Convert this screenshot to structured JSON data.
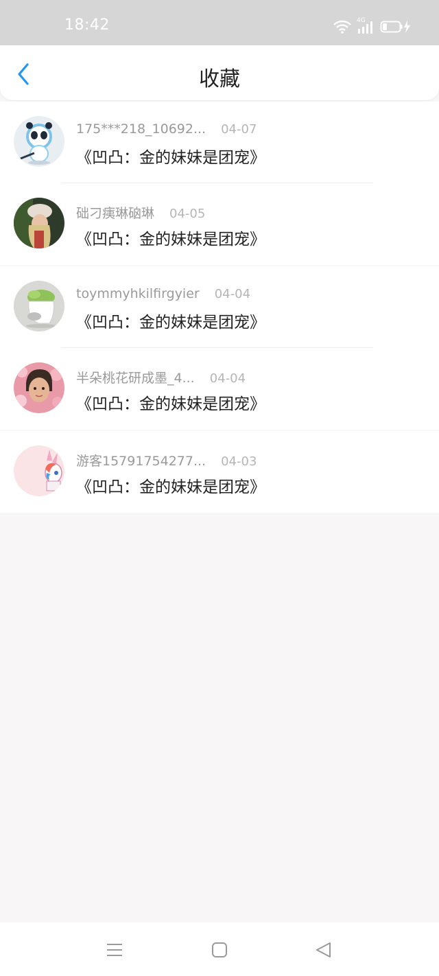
{
  "status_bar": {
    "time": "18:42",
    "icons": [
      "wifi-icon",
      "signal-4g-icon",
      "battery-charging-icon"
    ],
    "network_label": "4G"
  },
  "header": {
    "title": "收藏",
    "back_icon": "chevron-left-icon",
    "accent_color": "#2196f3"
  },
  "favorites": [
    {
      "user": "175***218_10692...",
      "date": "04-07",
      "title": "《凹凸：金的妹妹是团宠》",
      "avatar": "panda-mascot"
    },
    {
      "user": "础刁痍琳硇琳",
      "date": "04-05",
      "title": "《凹凸：金的妹妹是团宠》",
      "avatar": "person-hat"
    },
    {
      "user": "toymmyhkilfirgyier",
      "date": "04-04",
      "title": "《凹凸：金的妹妹是团宠》",
      "avatar": "plant-pot"
    },
    {
      "user": "半朵桃花研成墨_4...",
      "date": "04-04",
      "title": "《凹凸：金的妹妹是团宠》",
      "avatar": "girl-flowers"
    },
    {
      "user": "游客15791754277...",
      "date": "04-03",
      "title": "《凹凸：金的妹妹是团宠》",
      "avatar": "pony-cartoon"
    }
  ],
  "nav_bar": {
    "icons": [
      "menu-icon",
      "home-square-icon",
      "back-triangle-icon"
    ]
  }
}
